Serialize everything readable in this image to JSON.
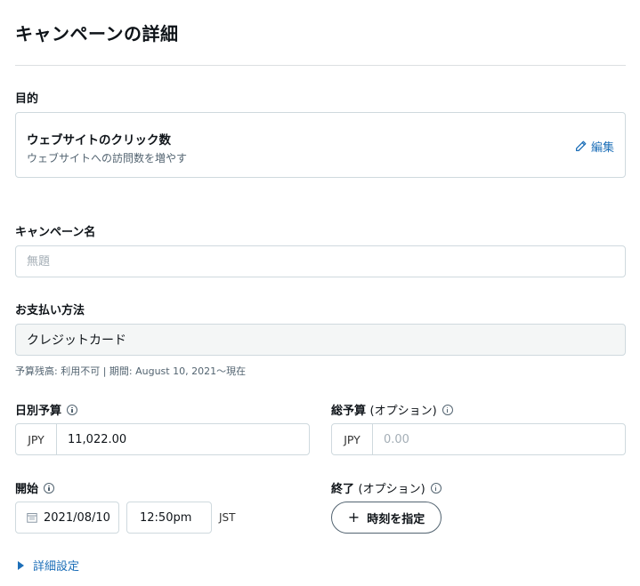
{
  "page": {
    "title": "キャンペーンの詳細"
  },
  "objective": {
    "label": "目的",
    "title": "ウェブサイトのクリック数",
    "subtitle": "ウェブサイトへの訪問数を増やす",
    "edit_label": "編集"
  },
  "campaign_name": {
    "label": "キャンペーン名",
    "placeholder": "無題",
    "value": ""
  },
  "payment": {
    "label": "お支払い方法",
    "value": "クレジットカード",
    "note": "予算残高: 利用不可 | 期間: August 10, 2021〜現在"
  },
  "daily_budget": {
    "label": "日別予算",
    "currency": "JPY",
    "value": "11,022.00"
  },
  "total_budget": {
    "label": "総予算",
    "optional": "(オプション)",
    "currency": "JPY",
    "placeholder": "0.00",
    "value": ""
  },
  "start": {
    "label": "開始",
    "date": "2021/08/10",
    "time": "12:50pm",
    "timezone": "JST"
  },
  "end": {
    "label": "終了",
    "optional": "(オプション)",
    "button_label": "時刻を指定"
  },
  "advanced": {
    "label": "詳細設定"
  },
  "colors": {
    "link": "#1d6fb8",
    "border": "#cfd9de",
    "muted": "#536471"
  }
}
